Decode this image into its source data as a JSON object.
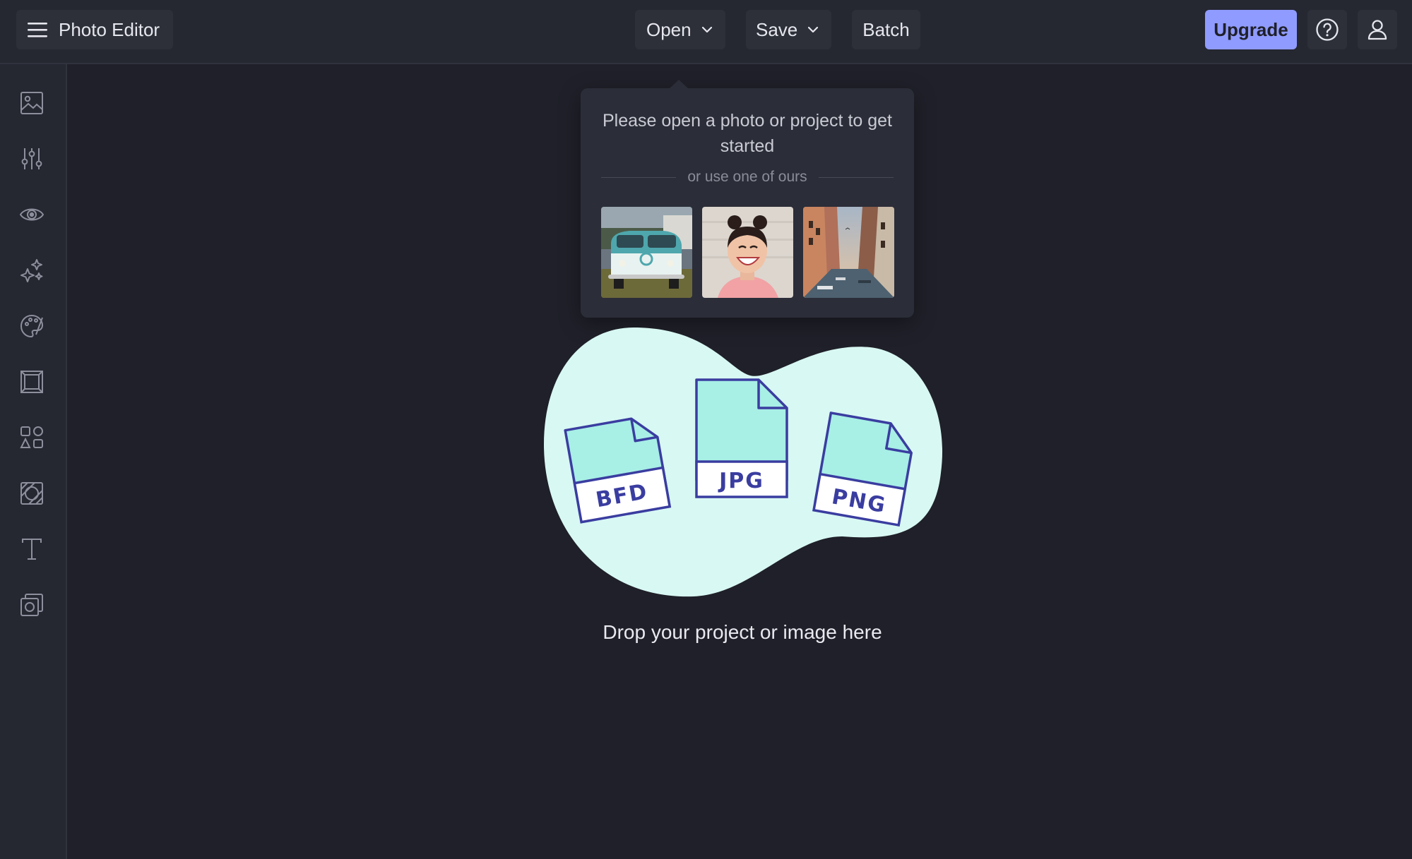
{
  "header": {
    "app_title": "Photo Editor",
    "menu_icon": "hamburger-menu-icon",
    "open_label": "Open",
    "save_label": "Save",
    "batch_label": "Batch",
    "upgrade_label": "Upgrade",
    "accent_color": "#8f9bff"
  },
  "sidebar": {
    "items": [
      {
        "icon": "image-icon"
      },
      {
        "icon": "adjustments-sliders-icon"
      },
      {
        "icon": "eye-icon"
      },
      {
        "icon": "sparkles-effects-icon"
      },
      {
        "icon": "paint-palette-icon"
      },
      {
        "icon": "frame-icon"
      },
      {
        "icon": "graphics-shapes-icon"
      },
      {
        "icon": "textures-icon"
      },
      {
        "icon": "text-icon"
      },
      {
        "icon": "overlays-icon"
      }
    ]
  },
  "popover": {
    "title": "Please open a photo or project to get started",
    "divider_text": "or use one of ours",
    "samples": [
      {
        "subject": "teal vintage van"
      },
      {
        "subject": "smiling woman portrait"
      },
      {
        "subject": "canal city street"
      }
    ]
  },
  "dropzone": {
    "file_types": [
      "BFD",
      "JPG",
      "PNG"
    ],
    "instruction": "Drop your project or image here",
    "blob_color": "#d8f8f3",
    "file_color": "#a8efe6",
    "file_outline_color": "#3a3da0"
  }
}
